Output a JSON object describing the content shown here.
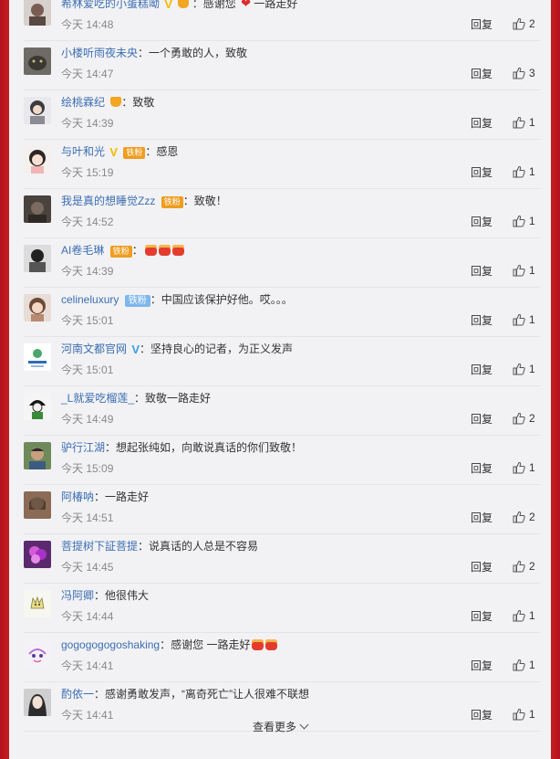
{
  "comments": [
    {
      "name": "希林爱吃的小蛋糕呦",
      "prefix": "",
      "text": "：感谢您",
      "suffix": "一路走好",
      "time": "今天 14:48",
      "reply": "回复",
      "likes": "2"
    },
    {
      "name": "小楼听雨夜未央",
      "text": "：一个勇敢的人，致敬",
      "time": "今天 14:47",
      "reply": "回复",
      "likes": "3"
    },
    {
      "name": "绘桃霖纪",
      "text": "：致敬",
      "time": "今天 14:39",
      "reply": "回复",
      "likes": "1"
    },
    {
      "name": "与叶和光",
      "fan_badge": "铁粉",
      "text": "：感恩",
      "time": "今天 15:19",
      "reply": "回复",
      "likes": "1"
    },
    {
      "name": "我是真的想睡觉Zzz",
      "fan_badge": "铁粉",
      "text": "：致敬！",
      "time": "今天 14:52",
      "reply": "回复",
      "likes": "1"
    },
    {
      "name": "AI卷毛琳",
      "fan_badge": "铁粉",
      "text": "：",
      "time": "今天 14:39",
      "reply": "回复",
      "likes": "1"
    },
    {
      "name": "celineluxury",
      "fan_badge": "铁粉",
      "text": "：中国应该保护好他。哎。。。",
      "time": "今天 15:01",
      "reply": "回复",
      "likes": "1"
    },
    {
      "name": "河南文都官网",
      "text": "：坚持良心的记者，为正义发声",
      "time": "今天 15:01",
      "reply": "回复",
      "likes": "1"
    },
    {
      "name": "_L就爱吃榴莲_",
      "text": "：致敬一路走好",
      "time": "今天 14:49",
      "reply": "回复",
      "likes": "2"
    },
    {
      "name": "驴行江湖",
      "text": "：想起张纯如，向敢说真话的你们致敬！",
      "time": "今天 15:09",
      "reply": "回复",
      "likes": "1"
    },
    {
      "name": "阿椿呐",
      "text": "：一路走好",
      "time": "今天 14:51",
      "reply": "回复",
      "likes": "2"
    },
    {
      "name": "菩提树下証菩提",
      "text": "：说真话的人总是不容易",
      "time": "今天 14:45",
      "reply": "回复",
      "likes": "2"
    },
    {
      "name": "冯阿卿",
      "text": "：他很伟大",
      "time": "今天 14:44",
      "reply": "回复",
      "likes": "1"
    },
    {
      "name": "gogogogogoshaking",
      "text": "：感谢您 一路走好",
      "time": "今天 14:41",
      "reply": "回复",
      "likes": "1"
    },
    {
      "name": "酌依一",
      "text": "：感谢勇敢发声，“离奇死亡”让人很难不联想",
      "time": "今天 14:41",
      "reply": "回复",
      "likes": "1"
    }
  ],
  "footer": {
    "more_label": "查看更多"
  },
  "colors": {
    "link": "#3c6eb0",
    "fan_badge": "#ef9d20",
    "vip_v": "#f5b800",
    "side_red": "#c11f24"
  }
}
